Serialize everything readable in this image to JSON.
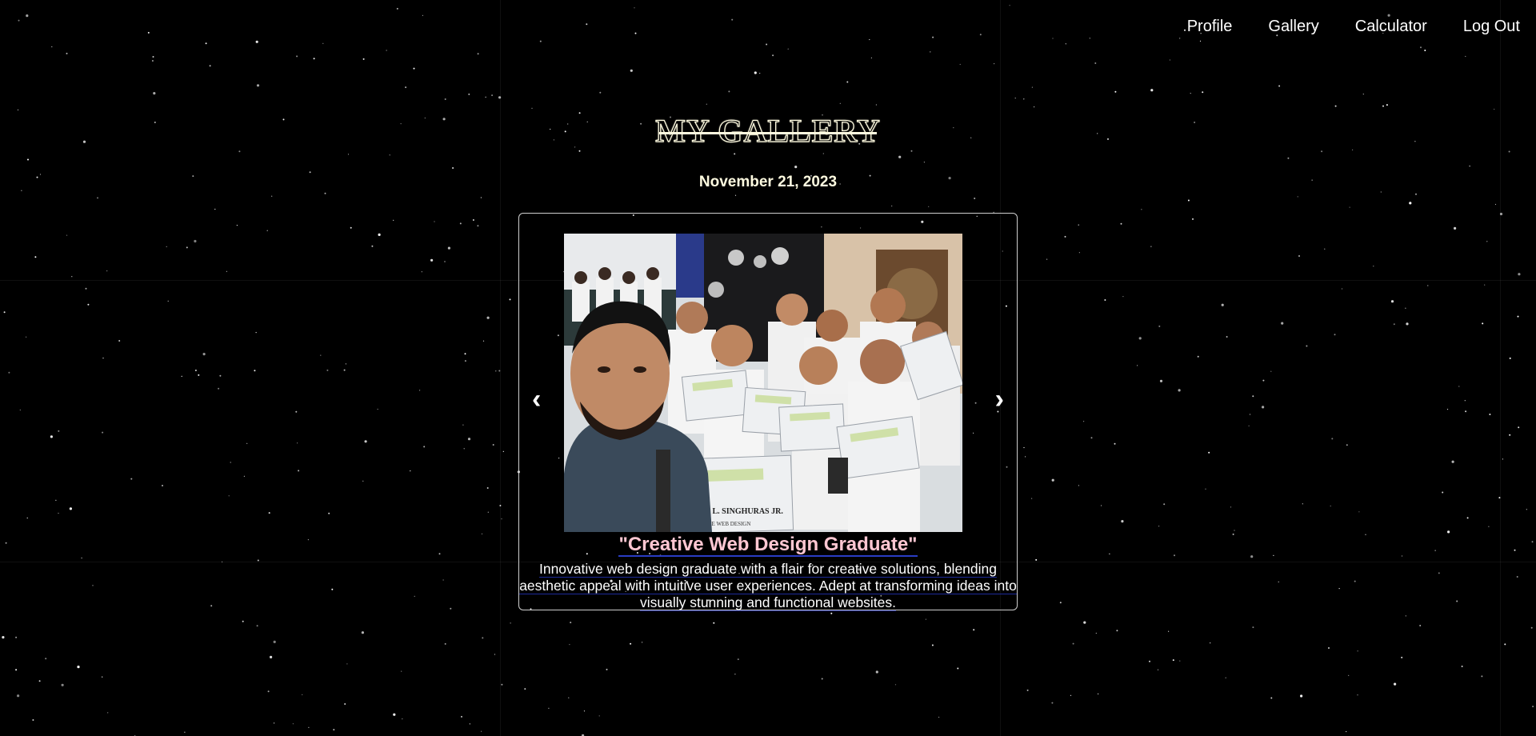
{
  "nav": {
    "items": [
      {
        "label": "Profile"
      },
      {
        "label": "Gallery"
      },
      {
        "label": "Calculator"
      },
      {
        "label": "Log Out"
      }
    ]
  },
  "page": {
    "title": "MY GALLERY",
    "date": "November 21, 2023"
  },
  "carousel": {
    "prev_label": "‹",
    "next_label": "›",
    "slide": {
      "image_desc": "Group selfie of graduates holding certificates",
      "certificate_name": "ARTURO L. SINGHURAS JR.",
      "certificate_course": "CREATIVE WEB DESIGN",
      "title": "\"Creative Web Design Graduate\"",
      "description": "Innovative web design graduate with a flair for creative solutions, blending aesthetic appeal with intuitive user experiences. Adept at transforming ideas into visually stunning and functional websites."
    }
  },
  "colors": {
    "background": "#000000",
    "title_outline": "#fffbe0",
    "caption_title": "#ffc7d2",
    "underline": "#2a3cc4",
    "card_border": "#cfcfcf"
  }
}
